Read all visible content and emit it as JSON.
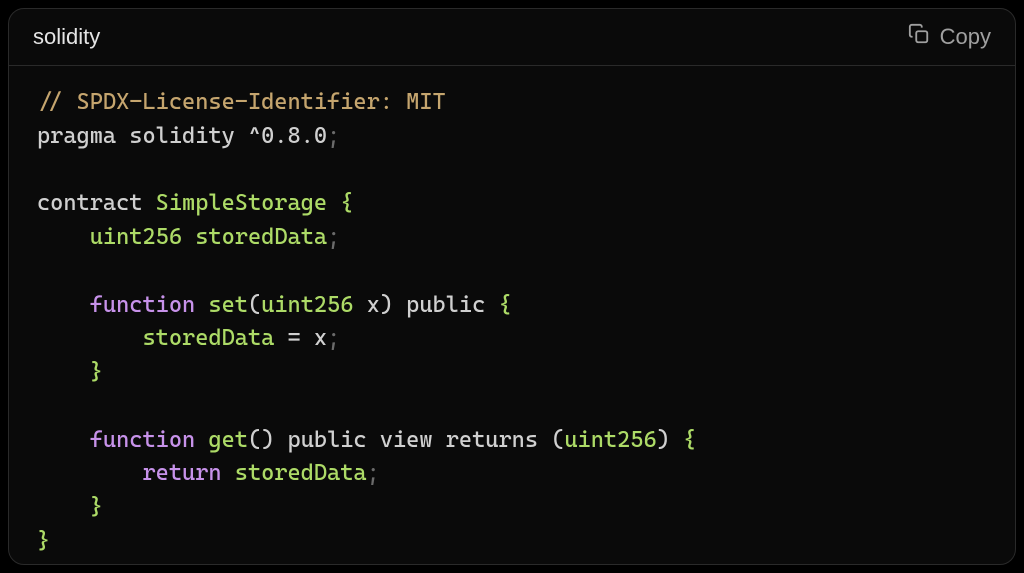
{
  "header": {
    "language_label": "solidity",
    "copy_label": "Copy"
  },
  "code": {
    "tokens": [
      [
        {
          "cls": "tok-spdx",
          "text": "// SPDX-License-Identifier: MIT"
        }
      ],
      [
        {
          "cls": "tok-plain",
          "text": "pragma solidity "
        },
        {
          "cls": "tok-plain",
          "text": "^"
        },
        {
          "cls": "tok-plain",
          "text": "0.8.0"
        },
        {
          "cls": "tok-semi",
          "text": ";"
        }
      ],
      [],
      [
        {
          "cls": "tok-plain",
          "text": "contract "
        },
        {
          "cls": "tok-var",
          "text": "SimpleStorage"
        },
        {
          "cls": "tok-plain",
          "text": " "
        },
        {
          "cls": "tok-var",
          "text": "{"
        }
      ],
      [
        {
          "cls": "tok-plain",
          "text": "    "
        },
        {
          "cls": "tok-var",
          "text": "uint256"
        },
        {
          "cls": "tok-plain",
          "text": " "
        },
        {
          "cls": "tok-var",
          "text": "storedData"
        },
        {
          "cls": "tok-semi",
          "text": ";"
        }
      ],
      [],
      [
        {
          "cls": "tok-plain",
          "text": "    "
        },
        {
          "cls": "tok-keyword",
          "text": "function"
        },
        {
          "cls": "tok-plain",
          "text": " "
        },
        {
          "cls": "tok-var",
          "text": "set"
        },
        {
          "cls": "tok-plain",
          "text": "("
        },
        {
          "cls": "tok-var",
          "text": "uint256"
        },
        {
          "cls": "tok-plain",
          "text": " x"
        },
        {
          "cls": "tok-plain",
          "text": ")"
        },
        {
          "cls": "tok-plain",
          "text": " public "
        },
        {
          "cls": "tok-var",
          "text": "{"
        }
      ],
      [
        {
          "cls": "tok-plain",
          "text": "        "
        },
        {
          "cls": "tok-var",
          "text": "storedData"
        },
        {
          "cls": "tok-plain",
          "text": " "
        },
        {
          "cls": "tok-plain",
          "text": "="
        },
        {
          "cls": "tok-plain",
          "text": " x"
        },
        {
          "cls": "tok-semi",
          "text": ";"
        }
      ],
      [
        {
          "cls": "tok-plain",
          "text": "    "
        },
        {
          "cls": "tok-var",
          "text": "}"
        }
      ],
      [],
      [
        {
          "cls": "tok-plain",
          "text": "    "
        },
        {
          "cls": "tok-keyword",
          "text": "function"
        },
        {
          "cls": "tok-plain",
          "text": " "
        },
        {
          "cls": "tok-var",
          "text": "get"
        },
        {
          "cls": "tok-plain",
          "text": "()"
        },
        {
          "cls": "tok-plain",
          "text": " public view returns "
        },
        {
          "cls": "tok-plain",
          "text": "("
        },
        {
          "cls": "tok-var",
          "text": "uint256"
        },
        {
          "cls": "tok-plain",
          "text": ")"
        },
        {
          "cls": "tok-plain",
          "text": " "
        },
        {
          "cls": "tok-var",
          "text": "{"
        }
      ],
      [
        {
          "cls": "tok-plain",
          "text": "        "
        },
        {
          "cls": "tok-keyword",
          "text": "return"
        },
        {
          "cls": "tok-plain",
          "text": " "
        },
        {
          "cls": "tok-var",
          "text": "storedData"
        },
        {
          "cls": "tok-semi",
          "text": ";"
        }
      ],
      [
        {
          "cls": "tok-plain",
          "text": "    "
        },
        {
          "cls": "tok-var",
          "text": "}"
        }
      ],
      [
        {
          "cls": "tok-var",
          "text": "}"
        }
      ]
    ]
  }
}
